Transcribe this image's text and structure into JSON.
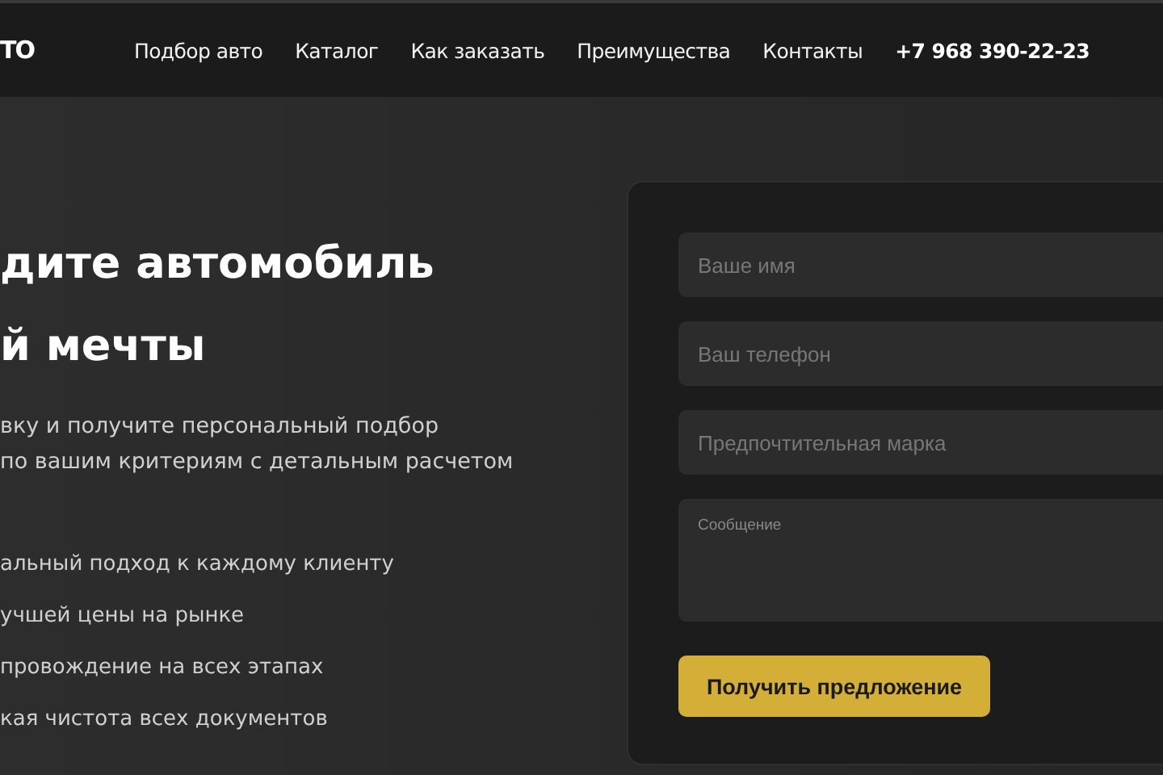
{
  "header": {
    "logo": "ТО",
    "nav": [
      {
        "label": "Подбор авто"
      },
      {
        "label": "Каталог"
      },
      {
        "label": "Как заказать"
      },
      {
        "label": "Преимущества"
      },
      {
        "label": "Контакты"
      }
    ],
    "phone": "+7 968 390-22-23"
  },
  "hero": {
    "title_lines": [
      "дите автомобиль",
      "й мечты"
    ],
    "subtitle_lines": [
      "вку и получите персональный подбор",
      "по вашим критериям с детальным расчетом"
    ],
    "features": [
      "альный подход к каждому клиенту",
      "учшей цены на рынке",
      "провождение на всех этапах",
      "кая чистота всех документов"
    ]
  },
  "form": {
    "fields": [
      {
        "kind": "input",
        "placeholder": "Ваше имя"
      },
      {
        "kind": "input",
        "placeholder": "Ваш телефон"
      },
      {
        "kind": "input",
        "placeholder": "Предпочтительная марка"
      },
      {
        "kind": "textarea",
        "placeholder": "Сообщение"
      }
    ],
    "submit": "Получить предложение"
  }
}
